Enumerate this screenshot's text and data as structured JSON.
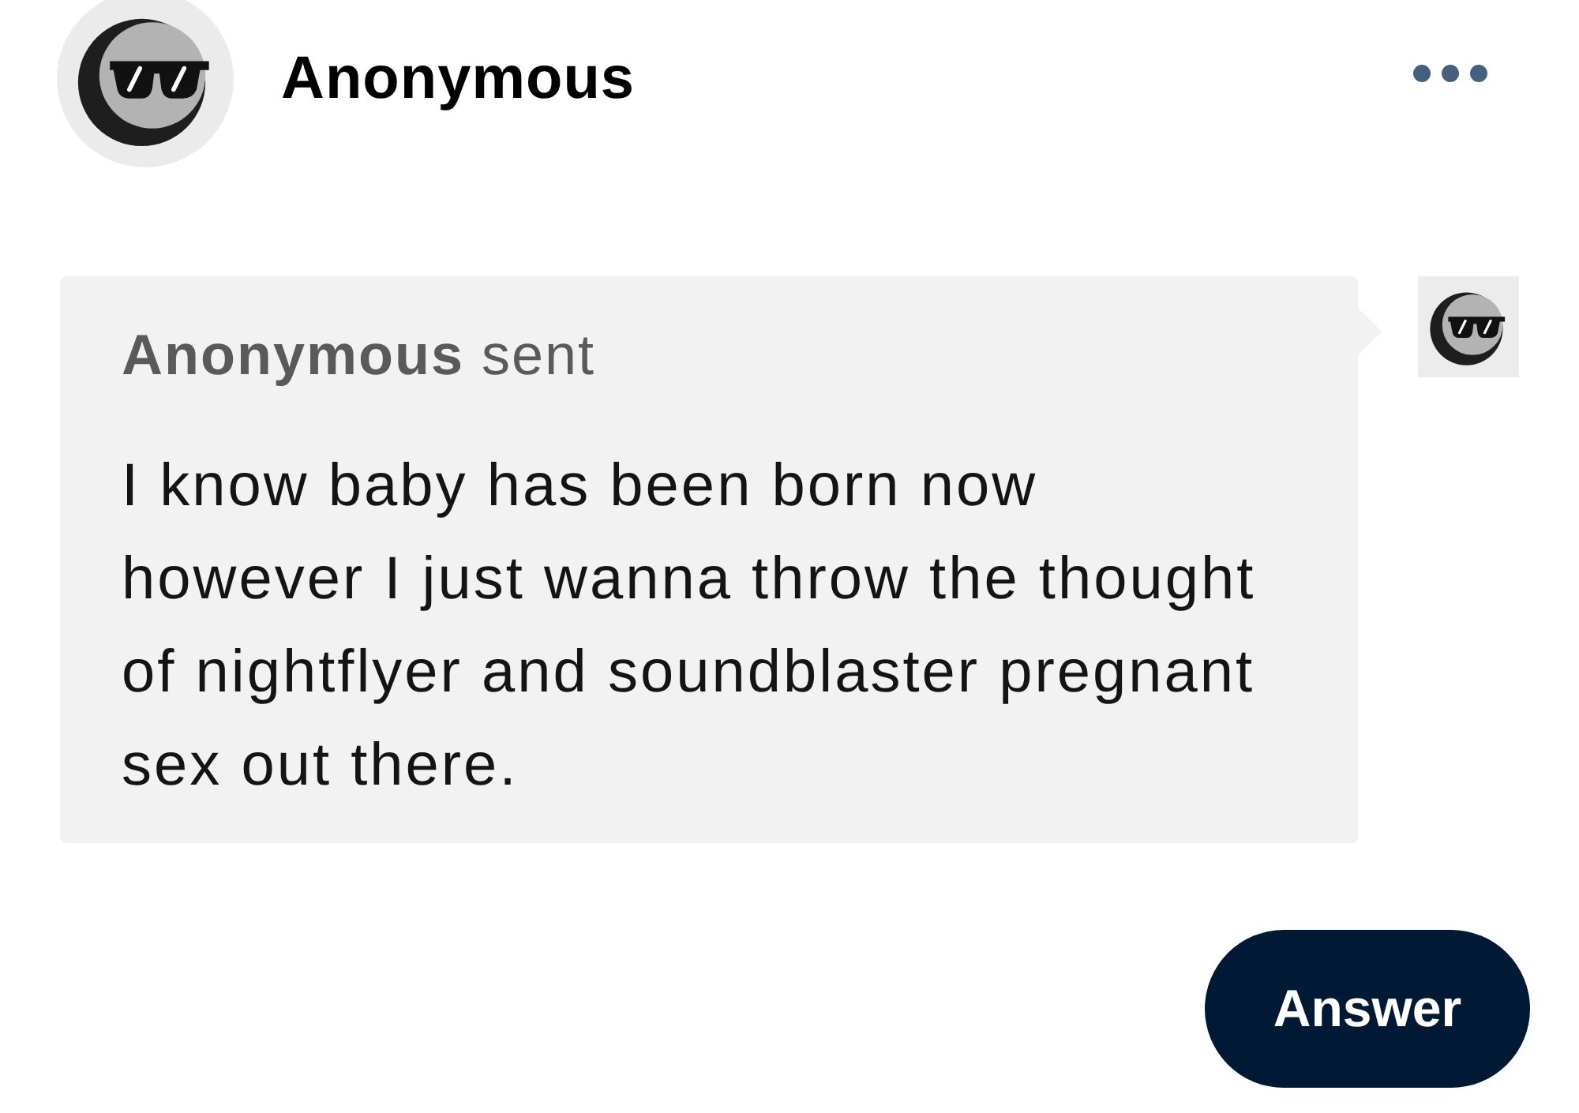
{
  "post": {
    "author": "Anonymous"
  },
  "ask": {
    "header": "**Anonymous** sent",
    "message": "I know baby has been born now however I just wanna throw the thought of nightflyer and soundblaster pregnant sex out there."
  },
  "answer_button": {
    "label": "Answer"
  }
}
